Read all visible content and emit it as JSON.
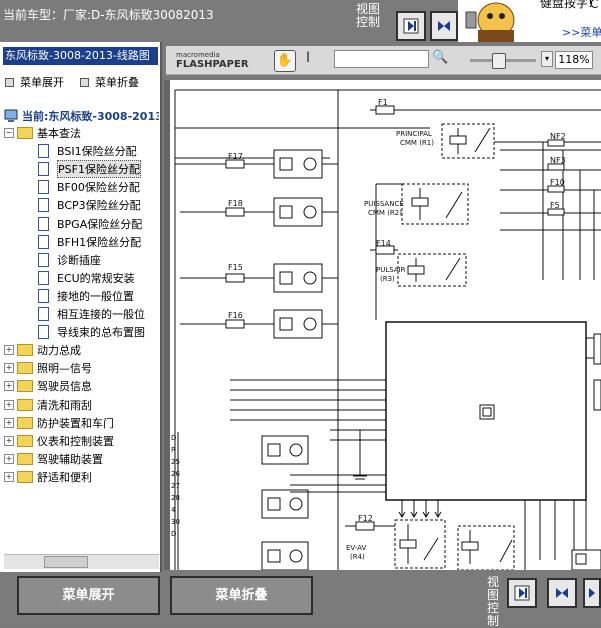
{
  "header": {
    "car_model": "当前车型：厂家:D-东风标致30082013",
    "view_control": "视图控制"
  },
  "popup": {
    "text": "健盘按字!",
    "edge_char": "C",
    "link": ">>菜单"
  },
  "left_panel": {
    "title": "东风标致-3008-2013-线路图",
    "expand_label": "菜单展开",
    "collapse_label": "菜单折叠",
    "current": "当前:东风标致-3008-2013",
    "tree": [
      {
        "label": "基本查法",
        "type": "folder",
        "expanded": true
      },
      {
        "label": "BSI1保险丝分配",
        "type": "doc"
      },
      {
        "label": "PSF1保险丝分配",
        "type": "doc",
        "selected": true
      },
      {
        "label": "BF00保险丝分配",
        "type": "doc"
      },
      {
        "label": "BCP3保险丝分配",
        "type": "doc"
      },
      {
        "label": "BPGA保险丝分配",
        "type": "doc"
      },
      {
        "label": "BFH1保险丝分配",
        "type": "doc"
      },
      {
        "label": "诊断插座",
        "type": "doc"
      },
      {
        "label": "ECU的常规安装",
        "type": "doc"
      },
      {
        "label": "接地的一般位置",
        "type": "doc"
      },
      {
        "label": "相互连接的一般位",
        "type": "doc"
      },
      {
        "label": "导线束的总布置图",
        "type": "doc"
      },
      {
        "label": "动力总成",
        "type": "folder"
      },
      {
        "label": "照明—信号",
        "type": "folder"
      },
      {
        "label": "驾驶员信息",
        "type": "folder"
      },
      {
        "label": "清洗和雨刮",
        "type": "folder"
      },
      {
        "label": "防护装置和车门",
        "type": "folder"
      },
      {
        "label": "仪表和控制装置",
        "type": "folder"
      },
      {
        "label": "驾驶辅助装置",
        "type": "folder"
      },
      {
        "label": "舒适和便利",
        "type": "folder"
      }
    ]
  },
  "viewer": {
    "logo_top": "macromedia",
    "logo_bottom": "FLASHPAPER",
    "zoom": "118%"
  },
  "diagram": {
    "fuses": [
      "F1",
      "F17",
      "F18",
      "F15",
      "F16",
      "F14",
      "NF2",
      "NF3",
      "F10",
      "F5",
      "F12"
    ],
    "relays": [
      {
        "line1": "PRINCIPAL",
        "line2": "CMM (R1)"
      },
      {
        "line1": "PUISSANCE",
        "line2": "CMM (R2)"
      },
      {
        "line1": "PULSAIR",
        "line2": "(R3)"
      },
      {
        "line1": "EV-AV",
        "line2": "(R4)"
      },
      {
        "line1": "EV-AV",
        "line2": ""
      }
    ],
    "left_labels": [
      "D",
      "R",
      "25",
      "26",
      "27",
      "28",
      "4",
      "30",
      "D"
    ]
  },
  "bottom": {
    "expand_button": "菜单展开",
    "collapse_button": "菜单折叠",
    "view_control": "视图控制"
  }
}
